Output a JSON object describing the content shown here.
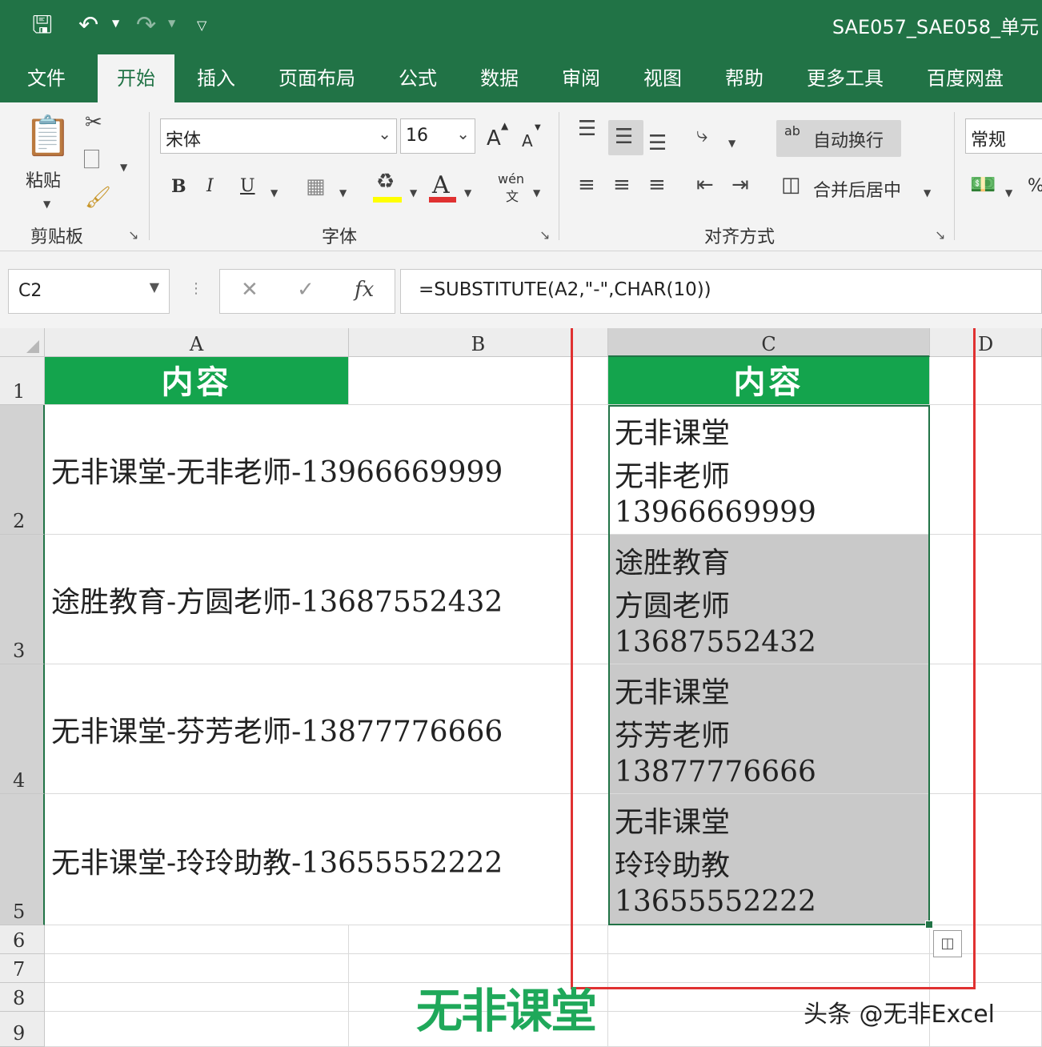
{
  "title_bar": {
    "title": "SAE057_SAE058_单元",
    "icons": [
      "save-icon",
      "undo-icon",
      "redo-icon",
      "customize-icon"
    ]
  },
  "ribbon_tabs": [
    "文件",
    "开始",
    "插入",
    "页面布局",
    "公式",
    "数据",
    "审阅",
    "视图",
    "帮助",
    "更多工具",
    "百度网盘"
  ],
  "active_tab": "开始",
  "clipboard": {
    "paste_label": "粘贴",
    "group_label": "剪贴板"
  },
  "font": {
    "name": "宋体",
    "size": "16",
    "grow": "A",
    "shrink": "A",
    "bold": "B",
    "italic": "I",
    "underline": "U",
    "font_color_glyph": "A",
    "phonetic": "wén",
    "phonetic_sub": "文",
    "group_label": "字体",
    "highlight_color": "#ffff00",
    "font_color": "#e03131"
  },
  "alignment": {
    "wrap_text": "自动换行",
    "merge_center": "合并后居中",
    "group_label": "对齐方式",
    "wrap_glyph": "ab"
  },
  "number": {
    "format": "常规",
    "percent": "%"
  },
  "formula_bar": {
    "name_box": "C2",
    "formula": "=SUBSTITUTE(A2,\"-\",CHAR(10))",
    "cancel": "✕",
    "confirm": "✓",
    "fx": "fx"
  },
  "columns": [
    "A",
    "B",
    "C",
    "D"
  ],
  "rows": [
    "1",
    "2",
    "3",
    "4",
    "5",
    "6",
    "7",
    "8",
    "9"
  ],
  "header_text": {
    "a1": "内容",
    "c1": "内容"
  },
  "data_rows": [
    {
      "a": "无非课堂-无非老师-13966669999",
      "c": [
        "无非课堂",
        "无非老师",
        "13966669999"
      ]
    },
    {
      "a": "途胜教育-方圆老师-13687552432",
      "c": [
        "途胜教育",
        "方圆老师",
        "13687552432"
      ]
    },
    {
      "a": "无非课堂-芬芳老师-13877776666",
      "c": [
        "无非课堂",
        "芬芳老师",
        "13877776666"
      ]
    },
    {
      "a": "无非课堂-玲玲助教-13655552222",
      "c": [
        "无非课堂",
        "玲玲助教",
        "13655552222"
      ]
    }
  ],
  "logo_text": "无非课堂",
  "watermark": "头条 @无非Excel",
  "colors": {
    "excel_green": "#217346",
    "header_green": "#14a44d",
    "highlight_red": "#e03131",
    "selection_gray": "#c9c9c9"
  }
}
